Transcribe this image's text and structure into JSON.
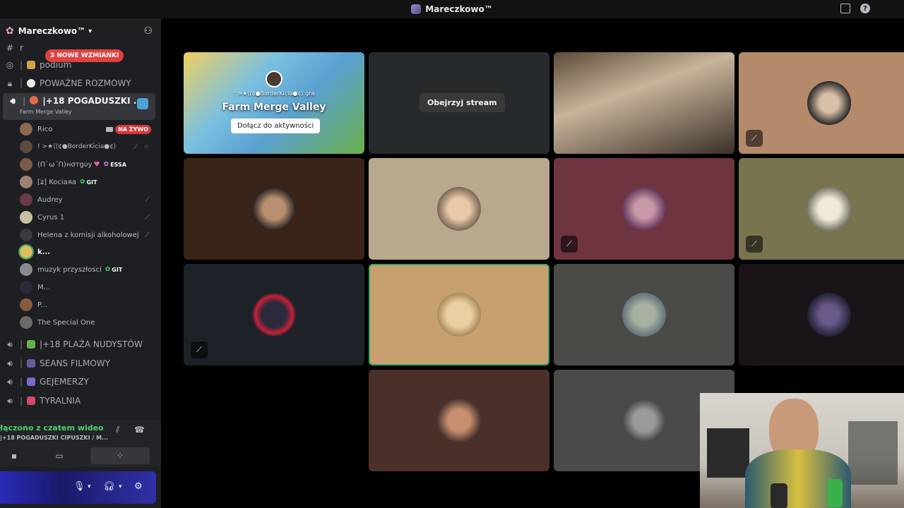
{
  "window": {
    "title": "Mareczkowo™"
  },
  "server": {
    "name": "Mareczkowo™",
    "mentions_pill": "3 NOWE WZMIANKI"
  },
  "channels": [
    {
      "icon": "hash",
      "name": "r"
    },
    {
      "icon": "podium",
      "name": "podium"
    },
    {
      "icon": "lock",
      "name": "POWAŻNE ROZMOWY"
    },
    {
      "icon": "speaker",
      "name": "|+18 POGADUSZKI ...",
      "sub": "Farm Merge Valley"
    },
    {
      "icon": "speaker",
      "name": "|+18 PLAŻA NUDYSTÓW"
    },
    {
      "icon": "speaker",
      "name": "SEANS FILMOWY"
    },
    {
      "icon": "speaker",
      "name": "GEJEMERZY"
    },
    {
      "icon": "speaker",
      "name": "TYRALNIA"
    }
  ],
  "members": [
    {
      "name": "Rico",
      "badge": "NA ŻYWO"
    },
    {
      "name": "! >★⟨⟨¢●BorderKicia●¢⟩"
    },
    {
      "name": "(ՈˋωˊՈ)нσтgυy",
      "tag": "ESSA"
    },
    {
      "name": "[ʑ] Kociaяa",
      "tag": "GIT"
    },
    {
      "name": "Audrey"
    },
    {
      "name": "Cyrus 1"
    },
    {
      "name": "Helena z komisji alkoholowej"
    },
    {
      "name": "k..."
    },
    {
      "name": "muzyk przyszłoscí",
      "tag": "GIT"
    },
    {
      "name": "M..."
    },
    {
      "name": "P..."
    },
    {
      "name": "The Special One"
    }
  ],
  "voice": {
    "status": "łączono z czatem wideo",
    "channel": "|+18 POGADUSZKI CIPUSZKI / M..."
  },
  "stage": {
    "activity": {
      "user": "! >★⟨⟨¢●BorderKicia●¢⟩ gra",
      "game": "Farm Merge Valley",
      "join": "Dołącz do aktywności"
    },
    "stream_button": "Obejrzyj stream"
  },
  "colors": {
    "accent_green": "#3ba55d",
    "live_red": "#da373c",
    "mention_red": "#e0423f"
  }
}
